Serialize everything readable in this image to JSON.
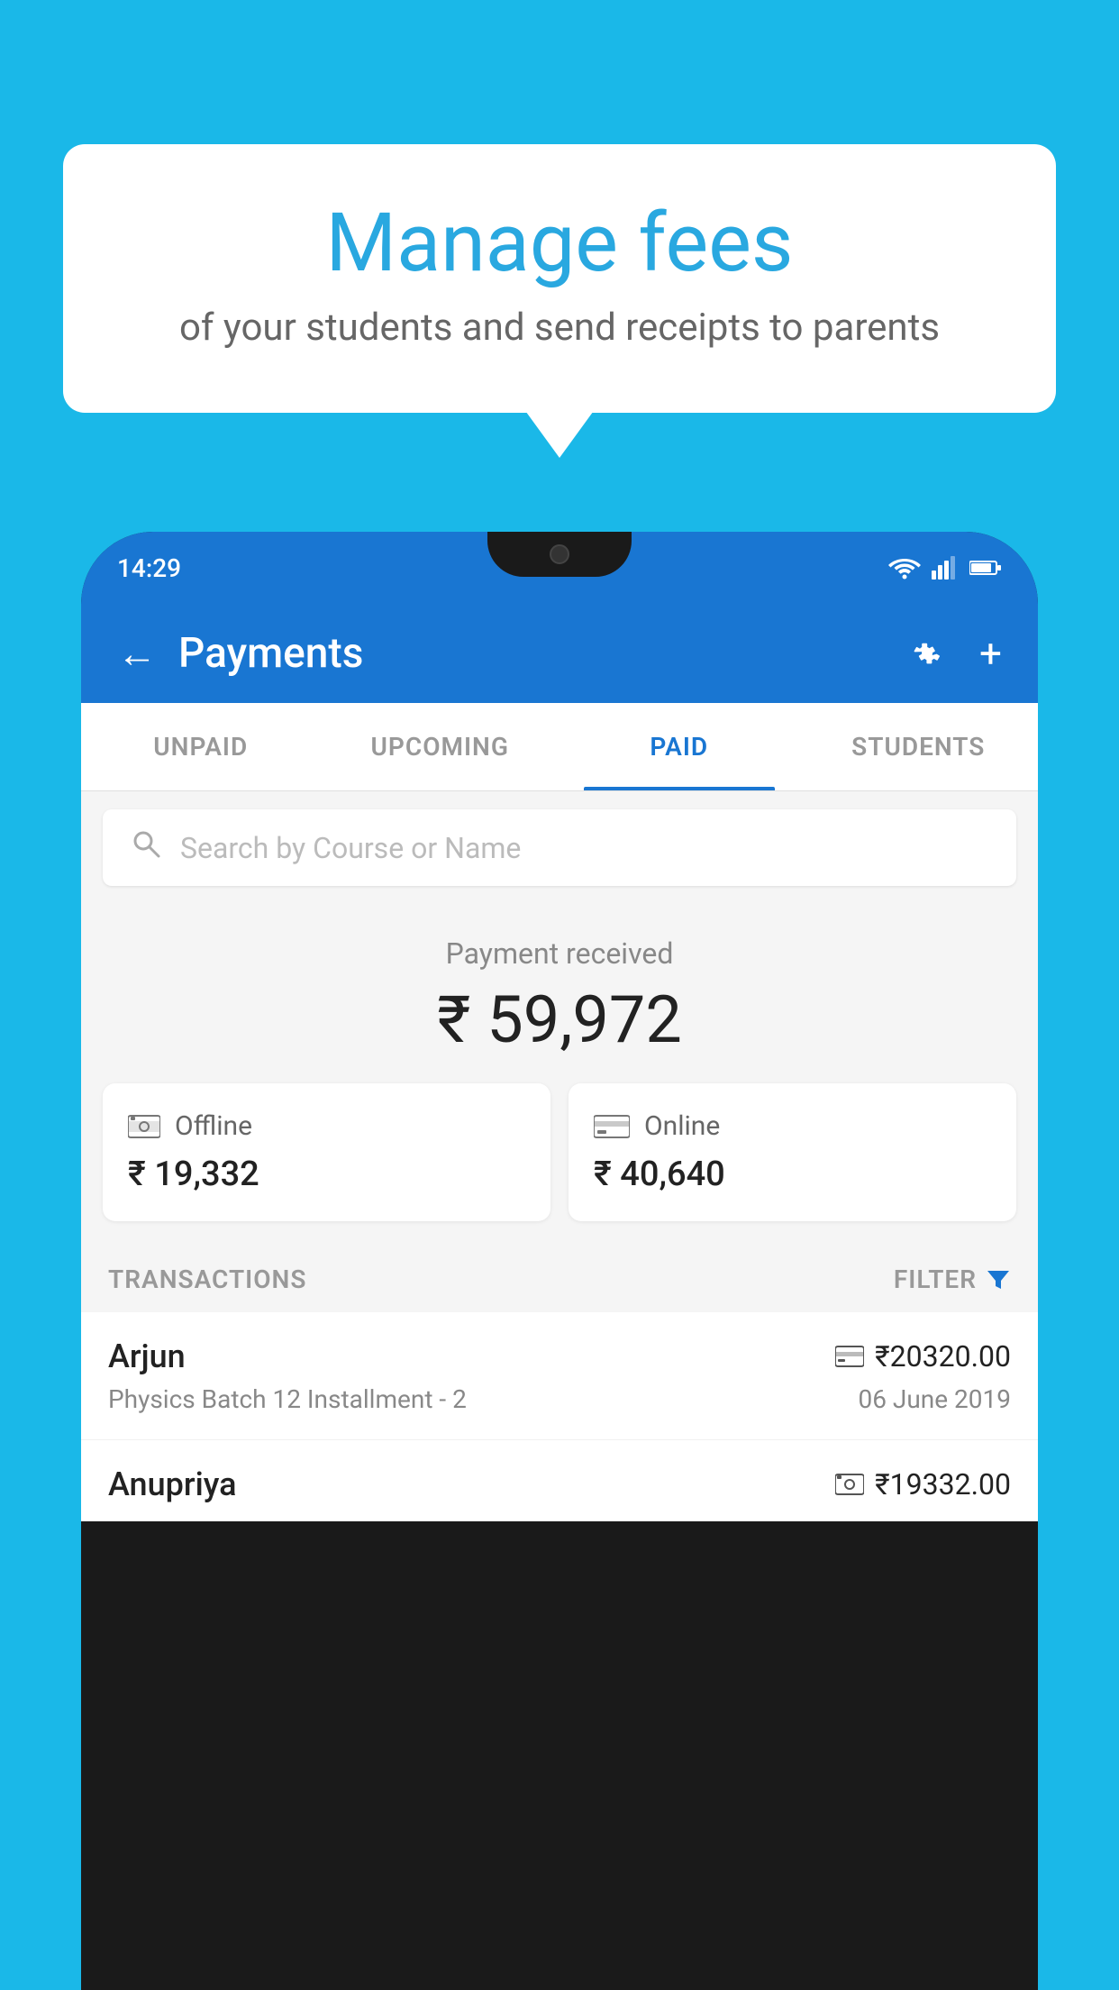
{
  "background_color": "#1ab8e8",
  "speech_bubble": {
    "title": "Manage fees",
    "subtitle": "of your students and send receipts to parents"
  },
  "phone": {
    "status_bar": {
      "time": "14:29",
      "icons": [
        "wifi",
        "signal",
        "battery"
      ]
    },
    "header": {
      "title": "Payments",
      "back_label": "←",
      "settings_icon": "gear",
      "add_icon": "+"
    },
    "tabs": [
      {
        "label": "UNPAID",
        "active": false
      },
      {
        "label": "UPCOMING",
        "active": false
      },
      {
        "label": "PAID",
        "active": true
      },
      {
        "label": "STUDENTS",
        "active": false
      }
    ],
    "search": {
      "placeholder": "Search by Course or Name"
    },
    "payment_summary": {
      "label": "Payment received",
      "amount": "₹ 59,972"
    },
    "cards": [
      {
        "type": "Offline",
        "amount": "₹ 19,332",
        "icon": "cash"
      },
      {
        "type": "Online",
        "amount": "₹ 40,640",
        "icon": "card"
      }
    ],
    "transactions_label": "TRANSACTIONS",
    "filter_label": "FILTER",
    "transactions": [
      {
        "name": "Arjun",
        "course": "Physics Batch 12 Installment - 2",
        "amount": "₹20320.00",
        "date": "06 June 2019",
        "payment_type": "online"
      },
      {
        "name": "Anupriya",
        "course": "",
        "amount": "₹19332.00",
        "date": "",
        "payment_type": "offline"
      }
    ]
  }
}
